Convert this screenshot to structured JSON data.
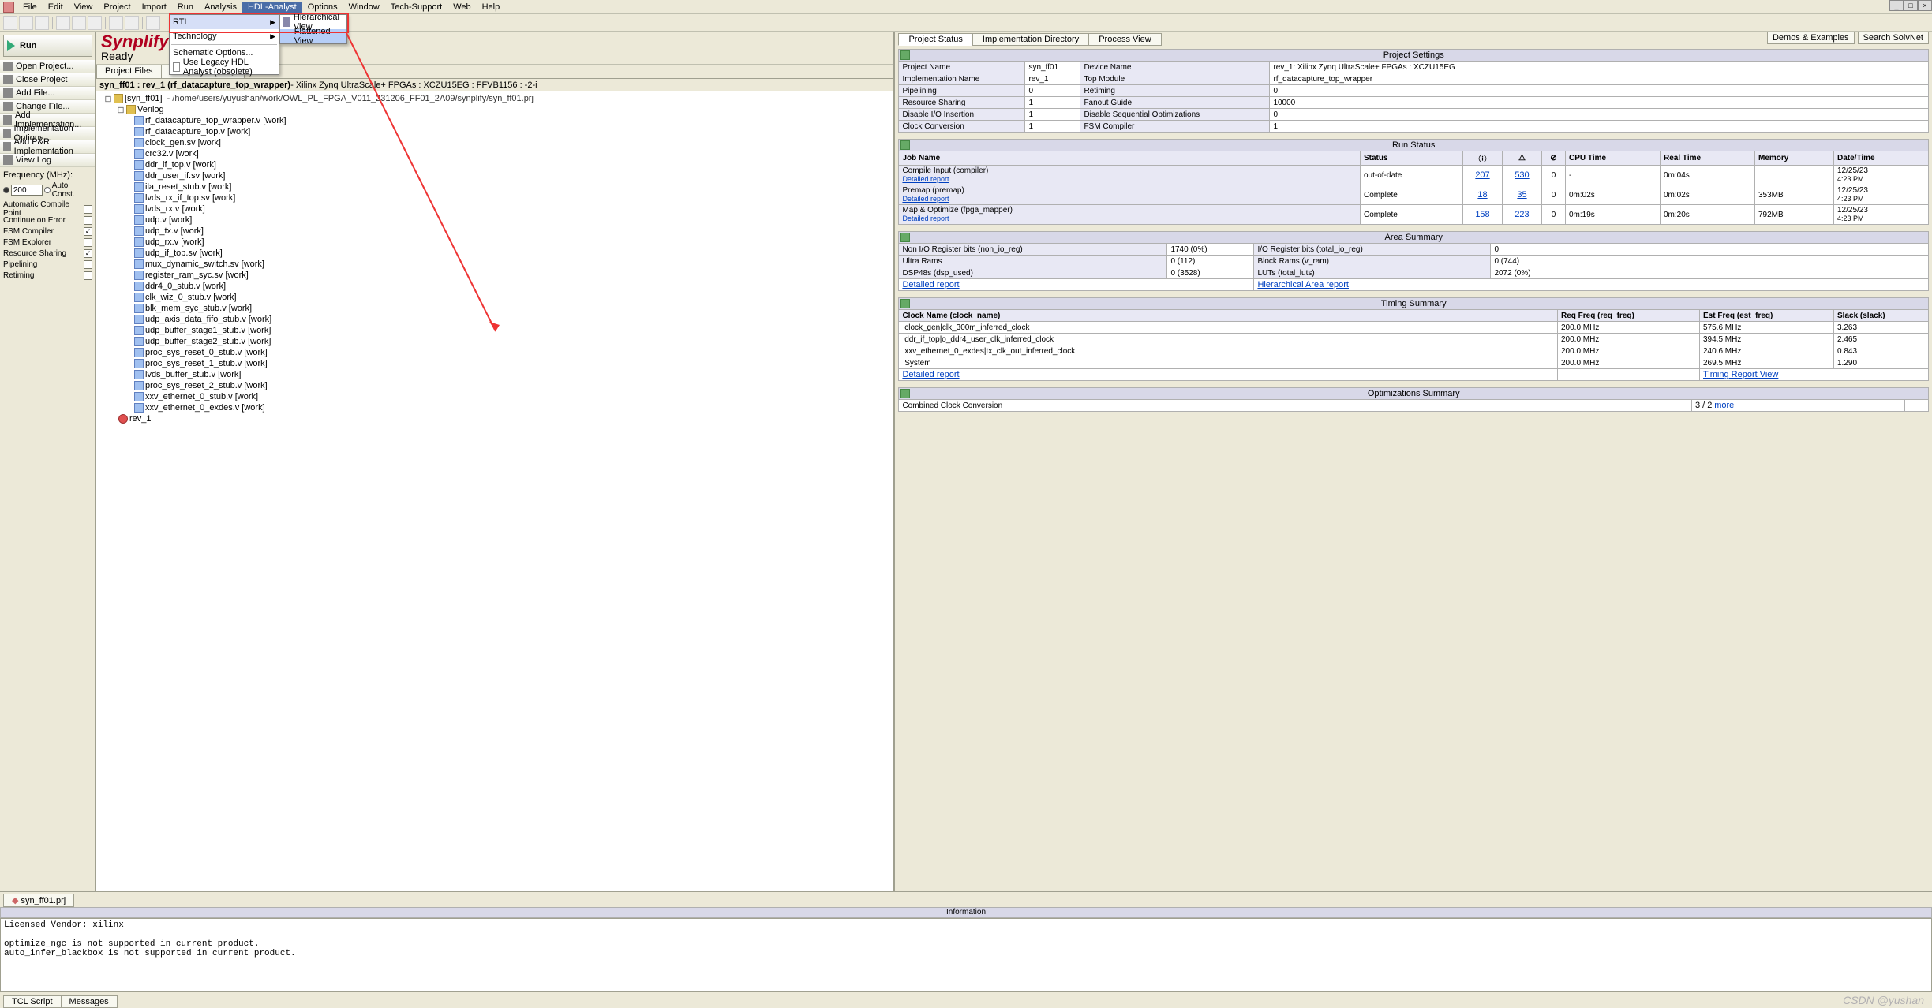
{
  "menu": {
    "items": [
      "File",
      "Edit",
      "View",
      "Project",
      "Import",
      "Run",
      "Analysis",
      "HDL-Analyst",
      "Options",
      "Window",
      "Tech-Support",
      "Web",
      "Help"
    ],
    "active_index": 7
  },
  "dropdown": {
    "items": [
      {
        "label": "RTL",
        "selected": true,
        "arrow": true,
        "accel": "R"
      },
      {
        "label": "Technology",
        "selected": false,
        "arrow": true,
        "accel": "T"
      },
      {
        "label": "Schematic Options...",
        "selected": false,
        "arrow": false
      },
      {
        "label": "Use Legacy HDL Analyst (obsolete)",
        "selected": false,
        "arrow": false,
        "checkbox": true
      }
    ]
  },
  "submenu": {
    "items": [
      {
        "label": "Hierarchical View",
        "icon": true,
        "accel": "H"
      },
      {
        "label": "Flattened View",
        "selected": true,
        "accel": "F"
      }
    ]
  },
  "synplify": {
    "title": "Synplify Pr",
    "ready": "Ready"
  },
  "run_button": "Run",
  "left_actions": [
    "Open Project...",
    "Close Project",
    "Add File...",
    "Change File...",
    "Add Implementation...",
    "Implementation Options...",
    "Add P&R Implementation",
    "View Log"
  ],
  "frequency": {
    "label": "Frequency (MHz):",
    "value": "200",
    "auto": "Auto Const."
  },
  "options": [
    {
      "label": "Automatic Compile Point",
      "checked": false
    },
    {
      "label": "Continue on Error",
      "checked": false
    },
    {
      "label": "FSM Compiler",
      "checked": true
    },
    {
      "label": "FSM Explorer",
      "checked": false
    },
    {
      "label": "Resource Sharing",
      "checked": true
    },
    {
      "label": "Pipelining",
      "checked": false
    },
    {
      "label": "Retiming",
      "checked": false
    }
  ],
  "center_tabs": [
    "Project Files",
    "Design Hierarchy"
  ],
  "breadcrumb": {
    "bold": "syn_ff01 : rev_1 (rf_datacapture_top_wrapper)",
    "rest": " - Xilinx Zynq UltraScale+ FPGAs : XCZU15EG : FFVB1156 : -2-i"
  },
  "tree": {
    "root": {
      "label": "[syn_ff01]",
      "path": "- /home/users/yuyushan/work/OWL_PL_FPGA_V011_231206_FF01_2A09/synplify/syn_ff01.prj"
    },
    "verilog_label": "Verilog",
    "files": [
      "rf_datacapture_top_wrapper.v [work]",
      "rf_datacapture_top.v [work]",
      "clock_gen.sv [work]  <sysv>",
      "crc32.v [work]",
      "ddr_if_top.v [work]",
      "ddr_user_if.sv [work]  <sysv>",
      "ila_reset_stub.v [work]",
      "lvds_rx_if_top.sv [work]  <sysv>",
      "lvds_rx.v [work]",
      "udp.v [work]",
      "udp_tx.v [work]",
      "udp_rx.v [work]",
      "udp_if_top.sv [work]  <sysv>",
      "mux_dynamic_switch.sv [work]  <sysv>",
      "register_ram_syc.sv [work]  <sysv>",
      "ddr4_0_stub.v [work]",
      "clk_wiz_0_stub.v [work]",
      "blk_mem_syc_stub.v [work]",
      "udp_axis_data_fifo_stub.v [work]",
      "udp_buffer_stage1_stub.v [work]",
      "udp_buffer_stage2_stub.v [work]",
      "proc_sys_reset_0_stub.v [work]",
      "proc_sys_reset_1_stub.v [work]",
      "lvds_buffer_stub.v [work]",
      "proc_sys_reset_2_stub.v [work]",
      "xxv_ethernet_0_stub.v [work]",
      "xxv_ethernet_0_exdes.v [work]"
    ],
    "rev": "rev_1"
  },
  "right_btns": [
    "Demos & Examples",
    "Search SolvNet"
  ],
  "right_tabs": [
    "Project Status",
    "Implementation Directory",
    "Process View"
  ],
  "project_settings": {
    "title": "Project Settings",
    "rows": [
      [
        "Project Name",
        "syn_ff01",
        "Device Name",
        "rev_1: Xilinx Zynq UltraScale+ FPGAs : XCZU15EG"
      ],
      [
        "Implementation Name",
        "rev_1",
        "Top Module",
        "rf_datacapture_top_wrapper"
      ],
      [
        "Pipelining",
        "0",
        "Retiming",
        "0"
      ],
      [
        "Resource Sharing",
        "1",
        "Fanout Guide",
        "10000"
      ],
      [
        "Disable I/O Insertion",
        "1",
        "Disable Sequential Optimizations",
        "0"
      ],
      [
        "Clock Conversion",
        "1",
        "FSM Compiler",
        "1"
      ]
    ]
  },
  "run_status": {
    "title": "Run Status",
    "headers": [
      "Job Name",
      "Status",
      "",
      "",
      "",
      "CPU Time",
      "Real Time",
      "Memory",
      "Date/Time"
    ],
    "icon_headers": [
      "info-icon",
      "warn-icon",
      "error-icon"
    ],
    "rows": [
      {
        "job": "Compile Input (compiler)",
        "report": "Detailed report",
        "status": "out-of-date",
        "i": "207",
        "w": "530",
        "e": "0",
        "cpu": "-",
        "real": "0m:04s",
        "mem": "",
        "dt": "12/25/23",
        "tm": "4:23 PM"
      },
      {
        "job": "Premap (premap)",
        "report": "Detailed report",
        "status": "Complete",
        "i": "18",
        "w": "35",
        "e": "0",
        "cpu": "0m:02s",
        "real": "0m:02s",
        "mem": "353MB",
        "dt": "12/25/23",
        "tm": "4:23 PM"
      },
      {
        "job": "Map & Optimize (fpga_mapper)",
        "report": "Detailed report",
        "status": "Complete",
        "i": "158",
        "w": "223",
        "e": "0",
        "cpu": "0m:19s",
        "real": "0m:20s",
        "mem": "792MB",
        "dt": "12/25/23",
        "tm": "4:23 PM"
      }
    ]
  },
  "area_summary": {
    "title": "Area Summary",
    "rows": [
      [
        "Non I/O Register bits (non_io_reg)",
        "1740 (0%)",
        "I/O Register bits (total_io_reg)",
        "0"
      ],
      [
        "Ultra Rams",
        "0 (112)",
        "Block Rams (v_ram)",
        "0 (744)"
      ],
      [
        "DSP48s (dsp_used)",
        "0 (3528)",
        "LUTs (total_luts)",
        "2072 (0%)"
      ]
    ],
    "links": [
      "Detailed report",
      "Hierarchical Area report"
    ]
  },
  "timing_summary": {
    "title": "Timing Summary",
    "headers": [
      "Clock Name (clock_name)",
      "Req Freq (req_freq)",
      "Est Freq (est_freq)",
      "Slack (slack)"
    ],
    "rows": [
      [
        "clock_gen|clk_300m_inferred_clock",
        "200.0 MHz",
        "575.6 MHz",
        "3.263"
      ],
      [
        "ddr_if_top|o_ddr4_user_clk_inferred_clock",
        "200.0 MHz",
        "394.5 MHz",
        "2.465"
      ],
      [
        "xxv_ethernet_0_exdes|tx_clk_out_inferred_clock",
        "200.0 MHz",
        "240.6 MHz",
        "0.843"
      ],
      [
        "System",
        "200.0 MHz",
        "269.5 MHz",
        "1.290"
      ]
    ],
    "links": [
      "Detailed report",
      "Timing Report View"
    ]
  },
  "opt_summary": {
    "title": "Optimizations Summary",
    "row": [
      "Combined Clock Conversion",
      "3 / 2",
      "more"
    ]
  },
  "bottom_tab": "syn_ff01.prj",
  "info_title": "Information",
  "console_text": "Licensed Vendor: xilinx\n\noptimize_ngc is not supported in current product.\nauto_infer_blackbox is not supported in current product.\n",
  "console_tabs": [
    "TCL Script",
    "Messages"
  ],
  "watermark": "CSDN @yushan"
}
